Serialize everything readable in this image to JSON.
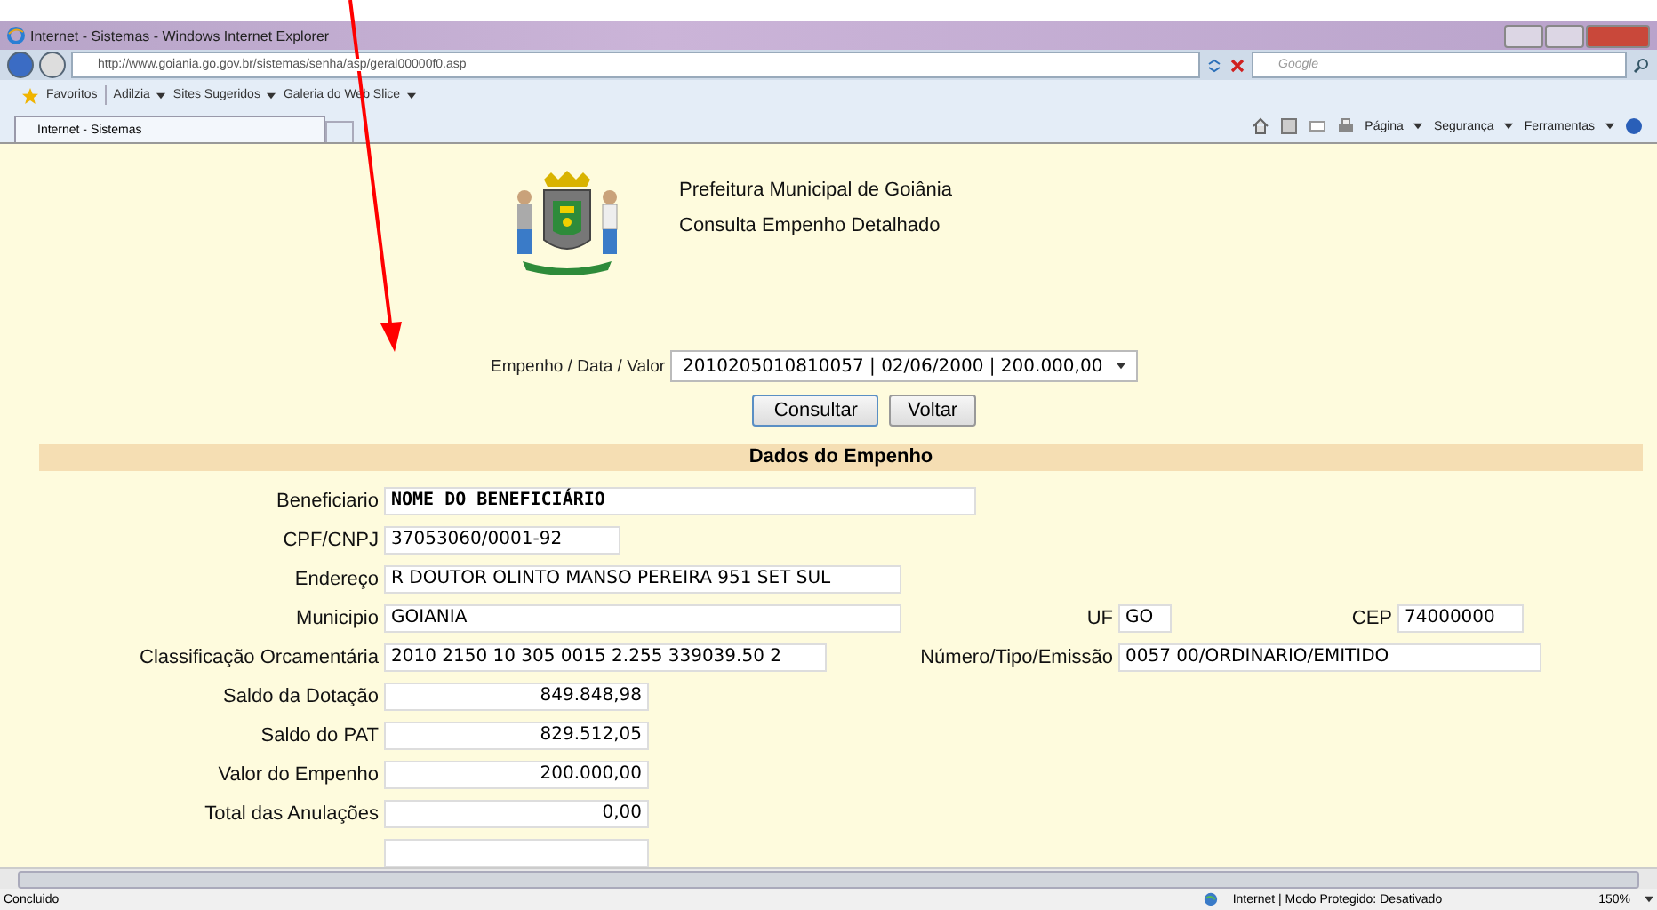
{
  "window": {
    "title": "Internet - Sistemas - Windows Internet Explorer"
  },
  "address_bar": {
    "url": "http://www.goiania.go.gov.br/sistemas/senha/asp/geral00000f0.asp",
    "search_placeholder": "Google"
  },
  "favorites_bar": {
    "label": "Favoritos",
    "items": [
      "Adilzia",
      "Sites Sugeridos",
      "Galeria do Web Slice"
    ]
  },
  "tab": {
    "label": "Internet - Sistemas"
  },
  "command_bar": [
    "Página",
    "Segurança",
    "Ferramentas"
  ],
  "page": {
    "organization": "Prefeitura Municipal de Goiânia",
    "subtitle": "Consulta Empenho Detalhado",
    "selector": {
      "label": "Empenho / Data / Valor",
      "value": "2010205010810057 | 02/06/2000 | 200.000,00"
    },
    "buttons": [
      "Consultar",
      "Voltar"
    ],
    "section_title": "Dados do Empenho",
    "rows": [
      {
        "fields": [
          {
            "label": "Beneficiario",
            "value": "NOME DO BENEFICIÁRIO",
            "kind": "name"
          }
        ]
      },
      {
        "fields": [
          {
            "label": "CPF/CNPJ",
            "value": "37053060/0001-92",
            "kind": "text"
          }
        ]
      },
      {
        "fields": [
          {
            "label": "Endereço",
            "value": "R DOUTOR OLINTO MANSO PEREIRA 951 SET SUL",
            "kind": "text"
          }
        ]
      },
      {
        "fields": [
          {
            "label": "Municipio",
            "value": "GOIANIA",
            "kind": "text"
          },
          {
            "label": "UF",
            "value": "GO",
            "kind": "text"
          },
          {
            "label": "CEP",
            "value": "74000000",
            "kind": "text"
          }
        ]
      },
      {
        "fields": [
          {
            "label": "Classificação Orcamentária",
            "value": "2010 2150 10 305 0015 2.255 339039.50 2",
            "kind": "text"
          },
          {
            "label": "Número/Tipo/Emissão",
            "value": "0057 00/ORDINARIO/EMITIDO",
            "kind": "text"
          }
        ]
      },
      {
        "fields": [
          {
            "label": "Saldo da Dotação",
            "value": "849.848,98",
            "kind": "amount"
          }
        ]
      },
      {
        "fields": [
          {
            "label": "Saldo do PAT",
            "value": "829.512,05",
            "kind": "amount"
          }
        ]
      },
      {
        "fields": [
          {
            "label": "Valor do Empenho",
            "value": "200.000,00",
            "kind": "amount"
          }
        ]
      },
      {
        "fields": [
          {
            "label": "Total das Anulações",
            "value": "0,00",
            "kind": "amount"
          }
        ]
      }
    ]
  },
  "status_bar": {
    "status": "Concluido",
    "zone": "Internet | Modo Protegido: Desativado",
    "zoom": "150%"
  }
}
